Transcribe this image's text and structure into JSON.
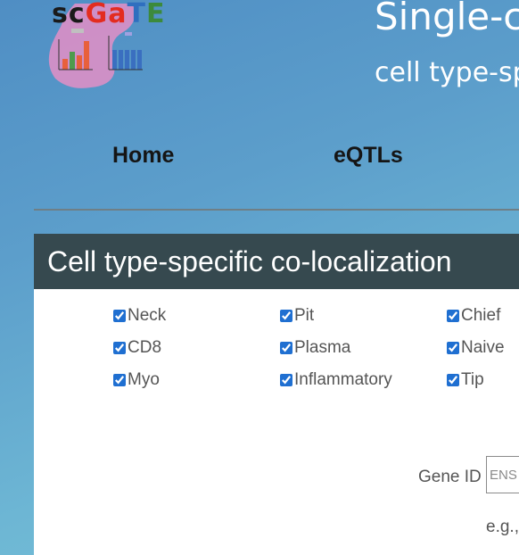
{
  "logo": {
    "letters": [
      {
        "char": "s",
        "color": "#1a1a1a"
      },
      {
        "char": "c",
        "color": "#1a1a1a"
      },
      {
        "char": "G",
        "color": "#e32c1f"
      },
      {
        "char": "a",
        "color": "#e32c1f"
      },
      {
        "char": "T",
        "color": "#2f6fbf"
      },
      {
        "char": "E",
        "color": "#3c8a3c"
      }
    ]
  },
  "header": {
    "title": "Single-c",
    "subtitle": "cell type-sp"
  },
  "nav": {
    "home": "Home",
    "eqtls": "eQTLs"
  },
  "panel": {
    "title": "Cell type-specific co-localization",
    "cell_types": [
      {
        "label": "Neck",
        "checked": true
      },
      {
        "label": "Pit",
        "checked": true
      },
      {
        "label": "Chief",
        "checked": true
      },
      {
        "label": "CD8",
        "checked": true
      },
      {
        "label": "Plasma",
        "checked": true
      },
      {
        "label": "Naive",
        "checked": true
      },
      {
        "label": "Myo",
        "checked": true
      },
      {
        "label": "Inflammatory",
        "checked": true
      },
      {
        "label": "Tip",
        "checked": true
      }
    ],
    "gene_id_label": "Gene ID",
    "gene_id_placeholder": "ENS",
    "example_text": "e.g.,"
  }
}
